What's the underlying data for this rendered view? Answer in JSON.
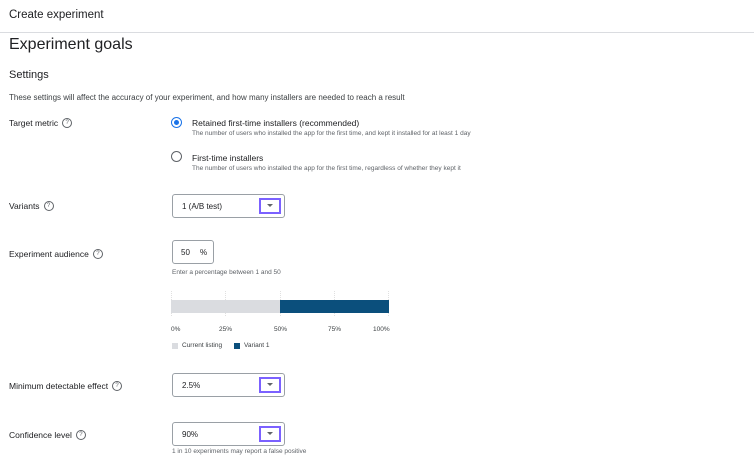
{
  "header": {
    "title": "Create experiment"
  },
  "page": {
    "title": "Experiment goals",
    "section_title": "Settings",
    "description": "These settings will affect the accuracy of your experiment, and how many installers are needed to reach a result"
  },
  "target_metric": {
    "label": "Target metric",
    "options": [
      {
        "title": "Retained first-time installers (recommended)",
        "desc": "The number of users who installed the app for the first time, and kept it installed for at least 1 day",
        "selected": true
      },
      {
        "title": "First-time installers",
        "desc": "The number of users who installed the app for the first time, regardless of whether they kept it",
        "selected": false
      }
    ]
  },
  "variants": {
    "label": "Variants",
    "value": "1 (A/B test)"
  },
  "audience": {
    "label": "Experiment audience",
    "value": "50",
    "unit": "%",
    "hint": "Enter a percentage between 1 and 50"
  },
  "chart_data": {
    "type": "bar",
    "categories": [
      "Current listing",
      "Variant 1"
    ],
    "values": [
      50,
      50
    ],
    "xlim": [
      0,
      100
    ],
    "ticks": [
      "0%",
      "25%",
      "50%",
      "75%",
      "100%"
    ],
    "colors": {
      "current": "#dadce0",
      "variant": "#0b4f7c"
    },
    "legend": [
      "Current listing",
      "Variant 1"
    ]
  },
  "mde": {
    "label": "Minimum detectable effect",
    "value": "2.5%"
  },
  "confidence": {
    "label": "Confidence level",
    "value": "90%",
    "hint": "1 in 10 experiments may report a false positive"
  },
  "colors": {
    "accent": "#1a73e8",
    "highlight": "#7b61ff"
  }
}
